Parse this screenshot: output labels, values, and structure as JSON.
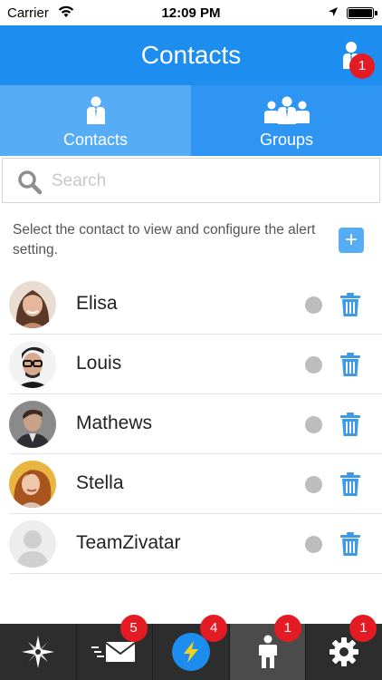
{
  "status_bar": {
    "carrier": "Carrier",
    "time": "12:09 PM"
  },
  "nav": {
    "title": "Contacts",
    "badge": "1"
  },
  "tabs": [
    {
      "label": "Contacts",
      "icon": "person-icon",
      "active": true
    },
    {
      "label": "Groups",
      "icon": "group-icon",
      "active": false
    }
  ],
  "search": {
    "placeholder": "Search",
    "value": ""
  },
  "instructions": "Select the contact to view and configure the alert setting.",
  "add_button": "+",
  "contacts": [
    {
      "name": "Elisa",
      "avatar_color": "#c98a6a"
    },
    {
      "name": "Louis",
      "avatar_color": "#3a3a3a"
    },
    {
      "name": "Mathews",
      "avatar_color": "#6b5a4e"
    },
    {
      "name": "Stella",
      "avatar_color": "#d49a3a"
    },
    {
      "name": "TeamZivatar",
      "avatar_color": "#d8d8d8"
    }
  ],
  "tab_bar": {
    "items": [
      {
        "icon": "compass-icon",
        "badge": ""
      },
      {
        "icon": "mail-icon",
        "badge": "5"
      },
      {
        "icon": "lightning-icon",
        "badge": "4"
      },
      {
        "icon": "person-icon",
        "badge": "1"
      },
      {
        "icon": "gear-icon",
        "badge": "1"
      }
    ]
  },
  "colors": {
    "primary": "#1d8ef0",
    "tab_active": "#56acf5",
    "tab_inactive": "#2f95f2",
    "badge": "#e51b23",
    "tab_bar": "#2d2d2d",
    "status_dot": "#bdbdbd",
    "icon_blue": "#3d9ae8"
  }
}
